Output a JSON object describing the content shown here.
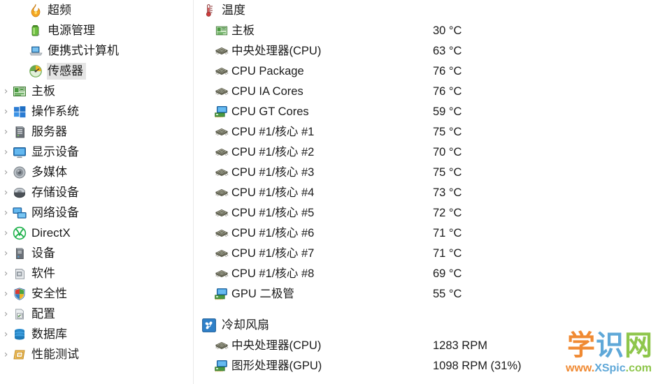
{
  "sidebar": {
    "items": [
      {
        "label": "超频",
        "icon": "flame-icon",
        "level": 2,
        "expandable": false,
        "selected": false
      },
      {
        "label": "电源管理",
        "icon": "battery-icon",
        "level": 2,
        "expandable": false,
        "selected": false
      },
      {
        "label": "便携式计算机",
        "icon": "laptop-icon",
        "level": 2,
        "expandable": false,
        "selected": false
      },
      {
        "label": "传感器",
        "icon": "sensor-gauge-icon",
        "level": 2,
        "expandable": false,
        "selected": true
      },
      {
        "label": "主板",
        "icon": "motherboard-icon",
        "level": 1,
        "expandable": true,
        "selected": false
      },
      {
        "label": "操作系统",
        "icon": "windows-icon",
        "level": 1,
        "expandable": true,
        "selected": false
      },
      {
        "label": "服务器",
        "icon": "server-icon",
        "level": 1,
        "expandable": true,
        "selected": false
      },
      {
        "label": "显示设备",
        "icon": "monitor-icon",
        "level": 1,
        "expandable": true,
        "selected": false
      },
      {
        "label": "多媒体",
        "icon": "speaker-icon",
        "level": 1,
        "expandable": true,
        "selected": false
      },
      {
        "label": "存储设备",
        "icon": "harddisk-icon",
        "level": 1,
        "expandable": true,
        "selected": false
      },
      {
        "label": "网络设备",
        "icon": "network-icon",
        "level": 1,
        "expandable": true,
        "selected": false
      },
      {
        "label": "DirectX",
        "icon": "directx-icon",
        "level": 1,
        "expandable": true,
        "selected": false
      },
      {
        "label": "设备",
        "icon": "device-icon",
        "level": 1,
        "expandable": true,
        "selected": false
      },
      {
        "label": "软件",
        "icon": "software-icon",
        "level": 1,
        "expandable": true,
        "selected": false
      },
      {
        "label": "安全性",
        "icon": "shield-icon",
        "level": 1,
        "expandable": true,
        "selected": false
      },
      {
        "label": "配置",
        "icon": "config-icon",
        "level": 1,
        "expandable": true,
        "selected": false
      },
      {
        "label": "数据库",
        "icon": "database-icon",
        "level": 1,
        "expandable": true,
        "selected": false
      },
      {
        "label": "性能测试",
        "icon": "benchmark-icon",
        "level": 1,
        "expandable": true,
        "selected": false
      }
    ],
    "chevron_glyph": "›"
  },
  "main": {
    "groups": [
      {
        "title": "温度",
        "icon": "thermometer-icon",
        "rows": [
          {
            "name": "主板",
            "icon": "motherboard-icon",
            "value": "30 °C"
          },
          {
            "name": "中央处理器(CPU)",
            "icon": "cpu-chip-icon",
            "value": "63 °C"
          },
          {
            "name": "CPU Package",
            "icon": "cpu-chip-icon",
            "value": "76 °C"
          },
          {
            "name": "CPU IA Cores",
            "icon": "cpu-chip-icon",
            "value": "76 °C"
          },
          {
            "name": "CPU GT Cores",
            "icon": "gpu-icon",
            "value": "59 °C"
          },
          {
            "name": "CPU #1/核心 #1",
            "icon": "cpu-chip-icon",
            "value": "75 °C"
          },
          {
            "name": "CPU #1/核心 #2",
            "icon": "cpu-chip-icon",
            "value": "70 °C"
          },
          {
            "name": "CPU #1/核心 #3",
            "icon": "cpu-chip-icon",
            "value": "75 °C"
          },
          {
            "name": "CPU #1/核心 #4",
            "icon": "cpu-chip-icon",
            "value": "73 °C"
          },
          {
            "name": "CPU #1/核心 #5",
            "icon": "cpu-chip-icon",
            "value": "72 °C"
          },
          {
            "name": "CPU #1/核心 #6",
            "icon": "cpu-chip-icon",
            "value": "71 °C"
          },
          {
            "name": "CPU #1/核心 #7",
            "icon": "cpu-chip-icon",
            "value": "71 °C"
          },
          {
            "name": "CPU #1/核心 #8",
            "icon": "cpu-chip-icon",
            "value": "69 °C"
          },
          {
            "name": "GPU 二极管",
            "icon": "gpu-icon",
            "value": "55 °C"
          }
        ]
      },
      {
        "title": "冷却风扇",
        "icon": "fan-icon",
        "rows": [
          {
            "name": "中央处理器(CPU)",
            "icon": "cpu-chip-icon",
            "value": "1283 RPM"
          },
          {
            "name": "图形处理器(GPU)",
            "icon": "gpu-icon",
            "value": "1098 RPM  (31%)"
          }
        ]
      }
    ]
  },
  "watermark": {
    "cn_1": "学",
    "cn_2": "识",
    "cn_3": "网",
    "url_1": "www.",
    "url_2": "XSpic",
    "url_3": ".com"
  },
  "colors": {
    "background": "#ffffff",
    "text": "#1b1b1b",
    "selection": "#e4e4e4",
    "divider": "#d8d8d8",
    "chevron": "#9b9b9b"
  }
}
